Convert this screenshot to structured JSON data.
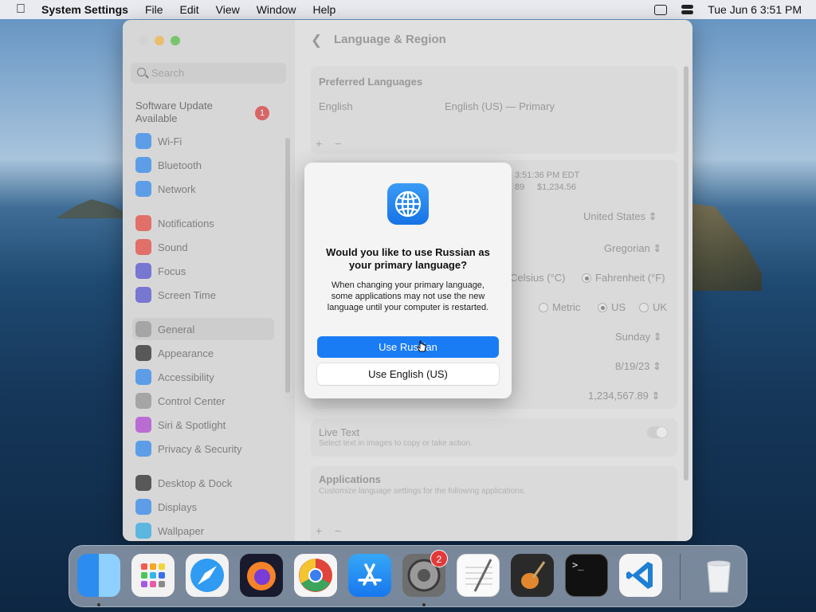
{
  "menubar": {
    "app_name": "System Settings",
    "menus": [
      "File",
      "Edit",
      "View",
      "Window",
      "Help"
    ],
    "clock": "Tue Jun 6  3:51 PM"
  },
  "sidebar": {
    "search_placeholder": "Search",
    "update_label": "Software Update Available",
    "update_badge": "1",
    "items": [
      {
        "label": "Wi-Fi",
        "icon": "wifi-icon",
        "color": "#3a8ff2"
      },
      {
        "label": "Bluetooth",
        "icon": "bluetooth-icon",
        "color": "#3a8ff2"
      },
      {
        "label": "Network",
        "icon": "globe-icon",
        "color": "#3a8ff2"
      },
      {
        "label": "Notifications",
        "icon": "bell-icon",
        "color": "#e8534a"
      },
      {
        "label": "Sound",
        "icon": "speaker-icon",
        "color": "#e8534a"
      },
      {
        "label": "Focus",
        "icon": "moon-icon",
        "color": "#5d5bd4"
      },
      {
        "label": "Screen Time",
        "icon": "hourglass-icon",
        "color": "#5d5bd4"
      },
      {
        "label": "General",
        "icon": "gear-icon",
        "color": "#9a9a9a"
      },
      {
        "label": "Appearance",
        "icon": "appearance-icon",
        "color": "#333333"
      },
      {
        "label": "Accessibility",
        "icon": "accessibility-icon",
        "color": "#3a8ff2"
      },
      {
        "label": "Control Center",
        "icon": "control-center-icon",
        "color": "#9a9a9a"
      },
      {
        "label": "Siri & Spotlight",
        "icon": "siri-icon",
        "color": "#b44fd6"
      },
      {
        "label": "Privacy & Security",
        "icon": "hand-icon",
        "color": "#3a8ff2"
      },
      {
        "label": "Desktop & Dock",
        "icon": "dock-icon",
        "color": "#333333"
      },
      {
        "label": "Displays",
        "icon": "sun-icon",
        "color": "#3a8ff2"
      },
      {
        "label": "Wallpaper",
        "icon": "wallpaper-icon",
        "color": "#3ab0e8"
      }
    ]
  },
  "page": {
    "title": "Language & Region",
    "preferred_languages_header": "Preferred Languages",
    "language_name": "English",
    "language_detail": "English (US) — Primary",
    "add": "+",
    "remove": "−",
    "preview_time": "3:51:36 PM EDT",
    "preview_number_a": "89",
    "preview_number_b": "$1,234.56",
    "region_value": "United States",
    "calendar_value": "Gregorian",
    "temp_celsius": "Celsius (°C)",
    "temp_fahrenheit": "Fahrenheit (°F)",
    "measure_metric": "Metric",
    "measure_us": "US",
    "measure_uk": "UK",
    "first_day_value": "Sunday",
    "date_format_value": "8/19/23",
    "number_format_value": "1,234,567.89",
    "live_text_title": "Live Text",
    "live_text_desc": "Select text in images to copy or take action.",
    "applications_title": "Applications",
    "applications_desc": "Customize language settings for the following applications."
  },
  "dialog": {
    "title": "Would you like to use Russian as your primary language?",
    "body": "When changing your primary language, some applications may not use the new language until your computer is restarted.",
    "primary_button": "Use Russian",
    "secondary_button": "Use English (US)"
  },
  "dock": {
    "apps": [
      "finder-icon",
      "launchpad-icon",
      "safari-icon",
      "firefox-icon",
      "chrome-icon",
      "app-store-icon",
      "system-settings-icon",
      "textedit-icon",
      "garageband-icon",
      "terminal-icon",
      "vscode-icon",
      "trash-icon"
    ],
    "settings_badge": "2",
    "terminal_prompt": ">_"
  }
}
